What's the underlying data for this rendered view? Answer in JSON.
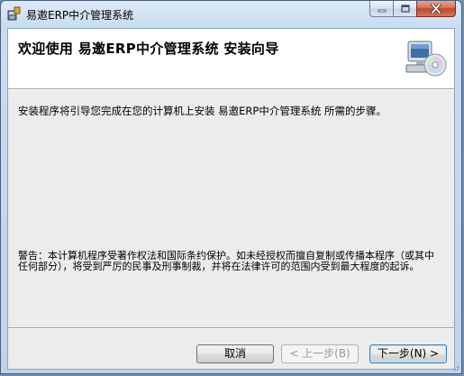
{
  "window": {
    "title": "易邀ERP中介管理系统"
  },
  "banner": {
    "title": "欢迎使用  易邀ERP中介管理系统  安装向导"
  },
  "content": {
    "intro": "安装程序将引导您完成在您的计算机上安装 易邀ERP中介管理系统 所需的步骤。",
    "warning": "警告：本计算机程序受著作权法和国际条约保护。如未经授权而擅自复制或传播本程序（或其中任何部分），将受到严厉的民事及刑事制裁，并将在法律许可的范围内受到最大程度的起诉。"
  },
  "buttons": {
    "cancel": "取消",
    "back": "< 上一步(B)",
    "next": "下一步(N) >"
  },
  "colors": {
    "close_button": "#c0462c",
    "dialog_bg": "#ececec",
    "banner_bg": "#ffffff"
  }
}
